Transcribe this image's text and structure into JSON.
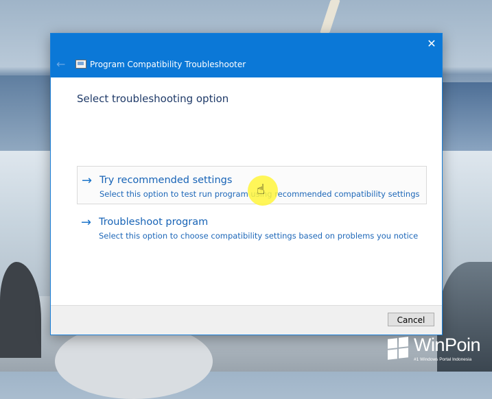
{
  "window": {
    "title": "Program Compatibility Troubleshooter",
    "close_glyph": "✕",
    "back_glyph": "←"
  },
  "content": {
    "heading": "Select troubleshooting option",
    "options": [
      {
        "arrow": "→",
        "title": "Try recommended settings",
        "description": "Select this option to test run program using recommended compatibility settings"
      },
      {
        "arrow": "→",
        "title": "Troubleshoot program",
        "description": "Select this option to choose compatibility settings based on problems you notice"
      }
    ]
  },
  "footer": {
    "cancel_label": "Cancel"
  },
  "watermark": {
    "brand": "WinPoin",
    "tagline": "#1 Windows Portal Indonesia"
  },
  "colors": {
    "titlebar": "#0b78d7",
    "link": "#1763b6",
    "heading": "#1f3a68"
  },
  "icons": {
    "app": "program-compatibility-icon",
    "cursor": "hand-pointer-icon"
  }
}
